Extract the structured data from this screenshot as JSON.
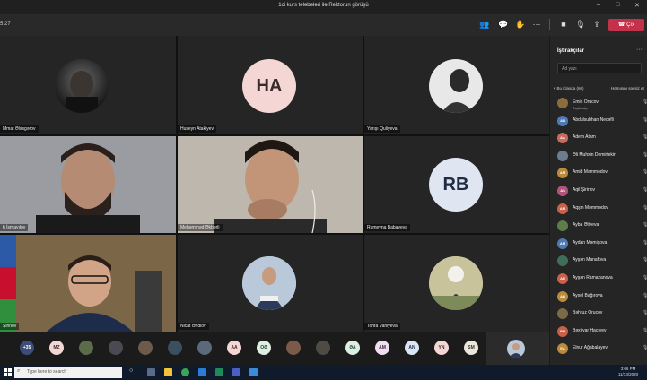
{
  "window": {
    "title": "1ci kurs tələbələri ilə Rektorun görüşü"
  },
  "toolbar": {
    "timer": "5:27",
    "leave_label": "Çıx"
  },
  "tiles": [
    {
      "name": "Mmat Ələsgərov",
      "kind": "photo"
    },
    {
      "name": "Huseyn Atakiyev",
      "kind": "initials",
      "initials": "HA"
    },
    {
      "name": "Yarışı Quliyeva",
      "kind": "photo"
    },
    {
      "name": "h İsmayılov",
      "kind": "video"
    },
    {
      "name": "Mehəmməd Əkbərli",
      "kind": "video"
    },
    {
      "name": "Rumeyna Babayeva",
      "kind": "initials",
      "initials": "RB"
    },
    {
      "name": "Şirinov",
      "kind": "video"
    },
    {
      "name": "Nicat Əhdiov",
      "kind": "photo"
    },
    {
      "name": "Tohfa Vahiyeva",
      "kind": "photo"
    }
  ],
  "strip": [
    "+35",
    "MZ",
    "",
    "",
    "",
    "",
    "",
    "AA",
    "OƏ",
    "",
    "",
    "ƏA",
    "AM",
    "AN",
    "YN",
    "SM"
  ],
  "panel": {
    "title": "İştirakçılar",
    "search_placeholder": "Ad yazı",
    "section": "Bu iclasda (60)",
    "mute_all": "Hamısını səssiz et",
    "participants": [
      {
        "name": "Emin Orucov",
        "role": "Təşkilatçı",
        "initials": "",
        "color": "#8a6d3b"
      },
      {
        "name": "Abdulsubhan Necəfli",
        "role": "",
        "initials": "AN",
        "color": "#4f7bb5"
      },
      {
        "name": "Adem Atam",
        "role": "",
        "initials": "AA",
        "color": "#c86a5c"
      },
      {
        "name": "Əli Muhsin Demirtekin",
        "role": "",
        "initials": "",
        "color": "#6b7d8f"
      },
      {
        "name": "Amid Məmmədov",
        "role": "",
        "initials": "AM",
        "color": "#b98b3a"
      },
      {
        "name": "Aqil Şirinov",
        "role": "",
        "initials": "AŞ",
        "color": "#b2547a"
      },
      {
        "name": "Aqşin Məmmədov",
        "role": "",
        "initials": "AM",
        "color": "#c8604a"
      },
      {
        "name": "Ayba Əliyeva",
        "role": "",
        "initials": "",
        "color": "#5f7d4a"
      },
      {
        "name": "Aydan Məmişova",
        "role": "",
        "initials": "AM",
        "color": "#4f7bb5"
      },
      {
        "name": "Ayşən Manafova",
        "role": "",
        "initials": "",
        "color": "#3e6d5a"
      },
      {
        "name": "Ayşən Ramazanova",
        "role": "",
        "initials": "AR",
        "color": "#c8604a"
      },
      {
        "name": "Aysel Bağırova",
        "role": "",
        "initials": "AB",
        "color": "#b98b3a"
      },
      {
        "name": "Bəhruz Orucov",
        "role": "",
        "initials": "",
        "color": "#7a6a4a"
      },
      {
        "name": "Bəxtiyar Hacıyev",
        "role": "",
        "initials": "BH",
        "color": "#c8604a"
      },
      {
        "name": "Elnur Ağabalayev",
        "role": "",
        "initials": "EA",
        "color": "#b98b3a"
      }
    ]
  },
  "taskbar": {
    "search_placeholder": "Type here to search",
    "time": "3:06 PM",
    "date": "11/13/2020"
  }
}
